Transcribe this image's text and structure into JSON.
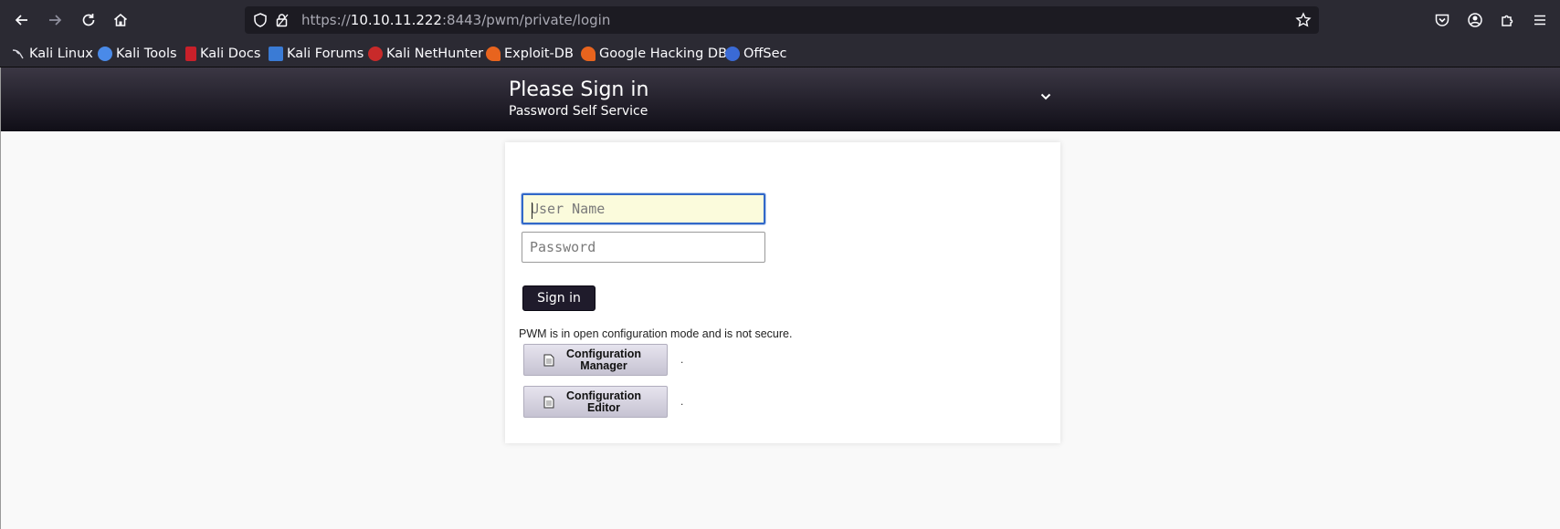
{
  "browser": {
    "url": {
      "protocol": "https://",
      "host": "10.10.11.222",
      "rest": ":8443/pwm/private/login"
    },
    "bookmarks": [
      {
        "label": "Kali Linux",
        "icon": "kali-dragon-icon",
        "color": "#2b2a33"
      },
      {
        "label": "Kali Tools",
        "icon": "kali-tools-icon",
        "color": "#4a8ae8"
      },
      {
        "label": "Kali Docs",
        "icon": "kali-docs-icon",
        "color": "#c8202a"
      },
      {
        "label": "Kali Forums",
        "icon": "kali-forums-icon",
        "color": "#3a7bd5"
      },
      {
        "label": "Kali NetHunter",
        "icon": "nethunter-icon",
        "color": "#c82a2a"
      },
      {
        "label": "Exploit-DB",
        "icon": "exploit-db-icon",
        "color": "#e8641e"
      },
      {
        "label": "Google Hacking DB",
        "icon": "ghdb-icon",
        "color": "#e8641e"
      },
      {
        "label": "OffSec",
        "icon": "offsec-icon",
        "color": "#3a6ad5"
      }
    ]
  },
  "header": {
    "title": "Please Sign in",
    "subtitle": "Password Self Service"
  },
  "form": {
    "username_placeholder": "User Name",
    "password_placeholder": "Password",
    "signin_label": "Sign in"
  },
  "notice": "PWM is in open configuration mode and is not secure.",
  "config_buttons": [
    {
      "label": "Configuration Manager",
      "trailing": "."
    },
    {
      "label": "Configuration Editor",
      "trailing": "."
    }
  ],
  "colors": {
    "header_dark": "#100e17",
    "accent_focus": "#3268c8",
    "signin_bg": "#1f1b2b"
  }
}
